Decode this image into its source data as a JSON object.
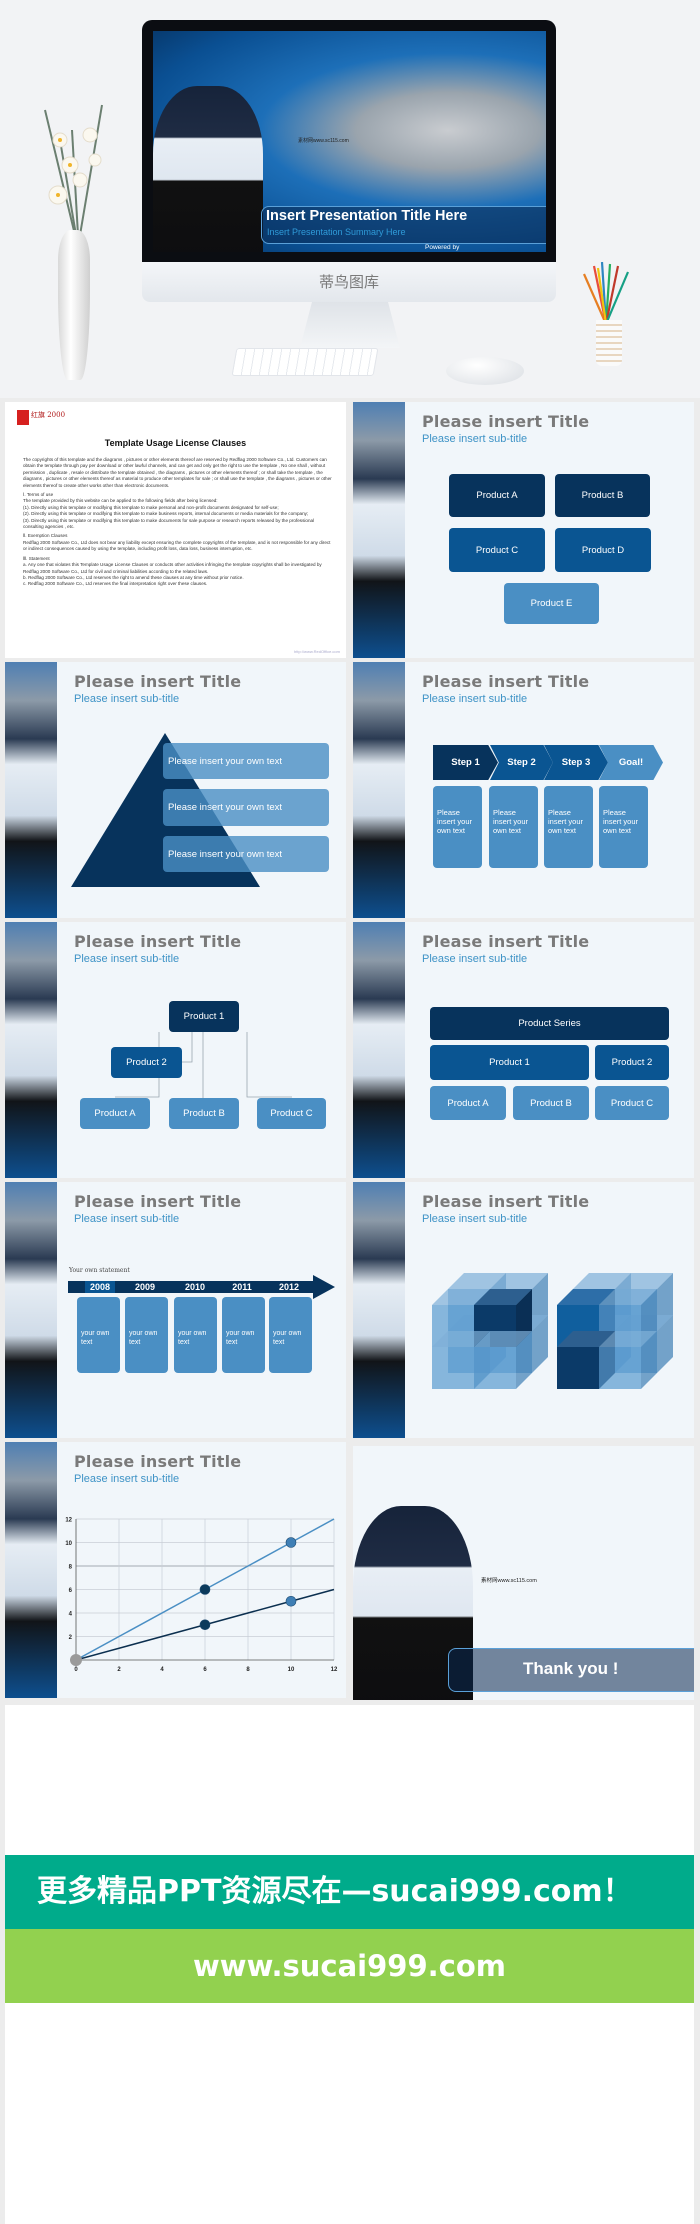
{
  "hero": {
    "title": "Insert Presentation Title Here",
    "summary": "Insert Presentation Summary Here",
    "powered": "Powered by",
    "brand": "蒂鸟图库",
    "map_watermark": "素材网www.sc115.com"
  },
  "license": {
    "logo": "红旗 2000",
    "title": "Template Usage License Clauses",
    "paragraphs": [
      "The copyrights of this template and the diagrams , pictures or other elements thereof are reserved by Redflag 2000 Software Co., Ltd. Customers can obtain the template through pay per download or other lawful channels, and can get and only get the right to use the template , No one shall , without permission , duplicate , resale or distribute the template obtained , the diagrams , pictures or other elements thereof ; or shall take the template , the diagrams , pictures or other elements thereof as material to produce other templates for sale ; or shall use the template , the diagrams , pictures or other elements thereof to create other works other than electronic documents.",
      "Ⅰ. Terms of use\nThe template provided by this website can be applied to the following fields after being licensed:\n(1). Directly using this template or modifying this template to make personal and non-profit documents designated for self-use;\n(2). Directly using this template or modifying this template to make business reports, internal documents or media materials for the company;\n(3). Directly using this template or modifying this template to make documents for sale purpose or research reports released by the professional consulting agencies , etc.",
      "Ⅱ. Exemption Clauses\nRedflag 2000 Software Co., Ltd does not bear any liability except ensuring the complete copyrights of the template, and is not responsible for any direct or indirect consequences caused by using the template, including profit loss, data loss, business interruption, etc.",
      "Ⅲ. Statement\na. Any one that violates this Template Usage License Clauses or conducts other activities infringing the template copyrights shall be investigated by Redflag 2000 Software Co., Ltd for civil and criminal liabilities according to the related laws.\nb. Redflag 2000 Software Co., Ltd reserves the right to amend these clauses at any time without prior notice.\nc. Redflag 2000 Software Co., Ltd reserves the final interpretation right over these clauses."
    ],
    "footer_link": "http://www.RedOffice.com"
  },
  "slide_title": "Please insert Title",
  "slide_subtitle": "Please insert sub-title",
  "products_grid": [
    "Product A",
    "Product B",
    "Product C",
    "Product D",
    "Product E"
  ],
  "pyramid": [
    "Please insert your own text",
    "Please insert your own text",
    "Please insert your own text"
  ],
  "steps": {
    "labels": [
      "Step 1",
      "Step 2",
      "Step 3",
      "Goal!"
    ],
    "text": "Please insert your own text"
  },
  "org": {
    "top": "Product 1",
    "mid": "Product 2",
    "bottom": [
      "Product A",
      "Product B",
      "Product C"
    ]
  },
  "series": {
    "top": "Product Series",
    "mid": [
      "Product 1",
      "Product 2"
    ],
    "bottom": [
      "Product A",
      "Product B",
      "Product C"
    ]
  },
  "timeline": {
    "statement": "Your own statement",
    "years": [
      "2008",
      "2009",
      "2010",
      "2011",
      "2012"
    ],
    "text": "your own text"
  },
  "chart_data": {
    "type": "line",
    "xlim": [
      0,
      12
    ],
    "ylim": [
      0,
      12
    ],
    "xticks": [
      0,
      2,
      4,
      6,
      8,
      10,
      12
    ],
    "yticks": [
      2,
      4,
      6,
      8,
      10,
      12
    ],
    "grid": true,
    "series": [
      {
        "x": [
          0,
          6,
          10,
          12
        ],
        "y": [
          0,
          6,
          10,
          12
        ],
        "color": "#4a8fc4",
        "markers": [
          6,
          10
        ]
      },
      {
        "x": [
          0,
          6,
          10,
          12
        ],
        "y": [
          0,
          3,
          5,
          6
        ],
        "color": "#0b2f4f",
        "markers": [
          6,
          10
        ]
      }
    ]
  },
  "thankyou": "Thank you !",
  "banner": {
    "line1": "更多精品PPT资源尽在—sucai999.com！",
    "line2": "www.sucai999.com"
  },
  "colors": {
    "dark": "#07335c",
    "mid": "#0a5592",
    "light": "#4a8fc4",
    "banner_green": "#00ab8b",
    "banner_lime": "#92d14f"
  }
}
